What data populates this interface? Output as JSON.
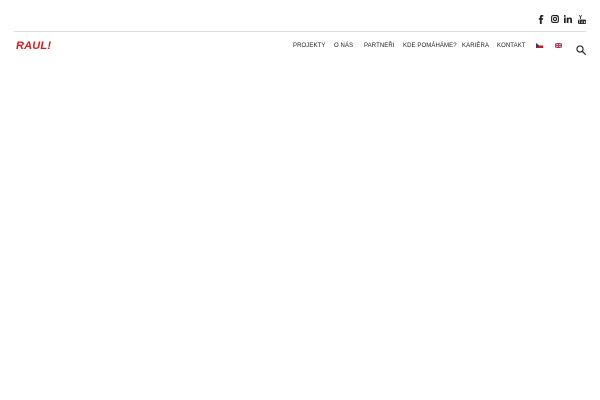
{
  "social": {
    "facebook": "facebook-icon",
    "instagram": "instagram-icon",
    "linkedin": "linkedin-icon",
    "youtube": "youtube-icon"
  },
  "header": {
    "logo": "RAUL!",
    "nav": [
      {
        "label": "PROJEKTY"
      },
      {
        "label": "O NÁS"
      },
      {
        "label": "PARTNEŘI"
      },
      {
        "label": "KDE POMÁHÁME?"
      },
      {
        "label": "KARIÉRA"
      },
      {
        "label": "KONTAKT"
      }
    ],
    "languages": [
      "czech-flag-icon",
      "uk-flag-icon"
    ],
    "search_icon": "search-icon"
  },
  "colors": {
    "brand": "#e3171d",
    "text": "#222222",
    "divider": "#dddddd",
    "background": "#ffffff"
  }
}
